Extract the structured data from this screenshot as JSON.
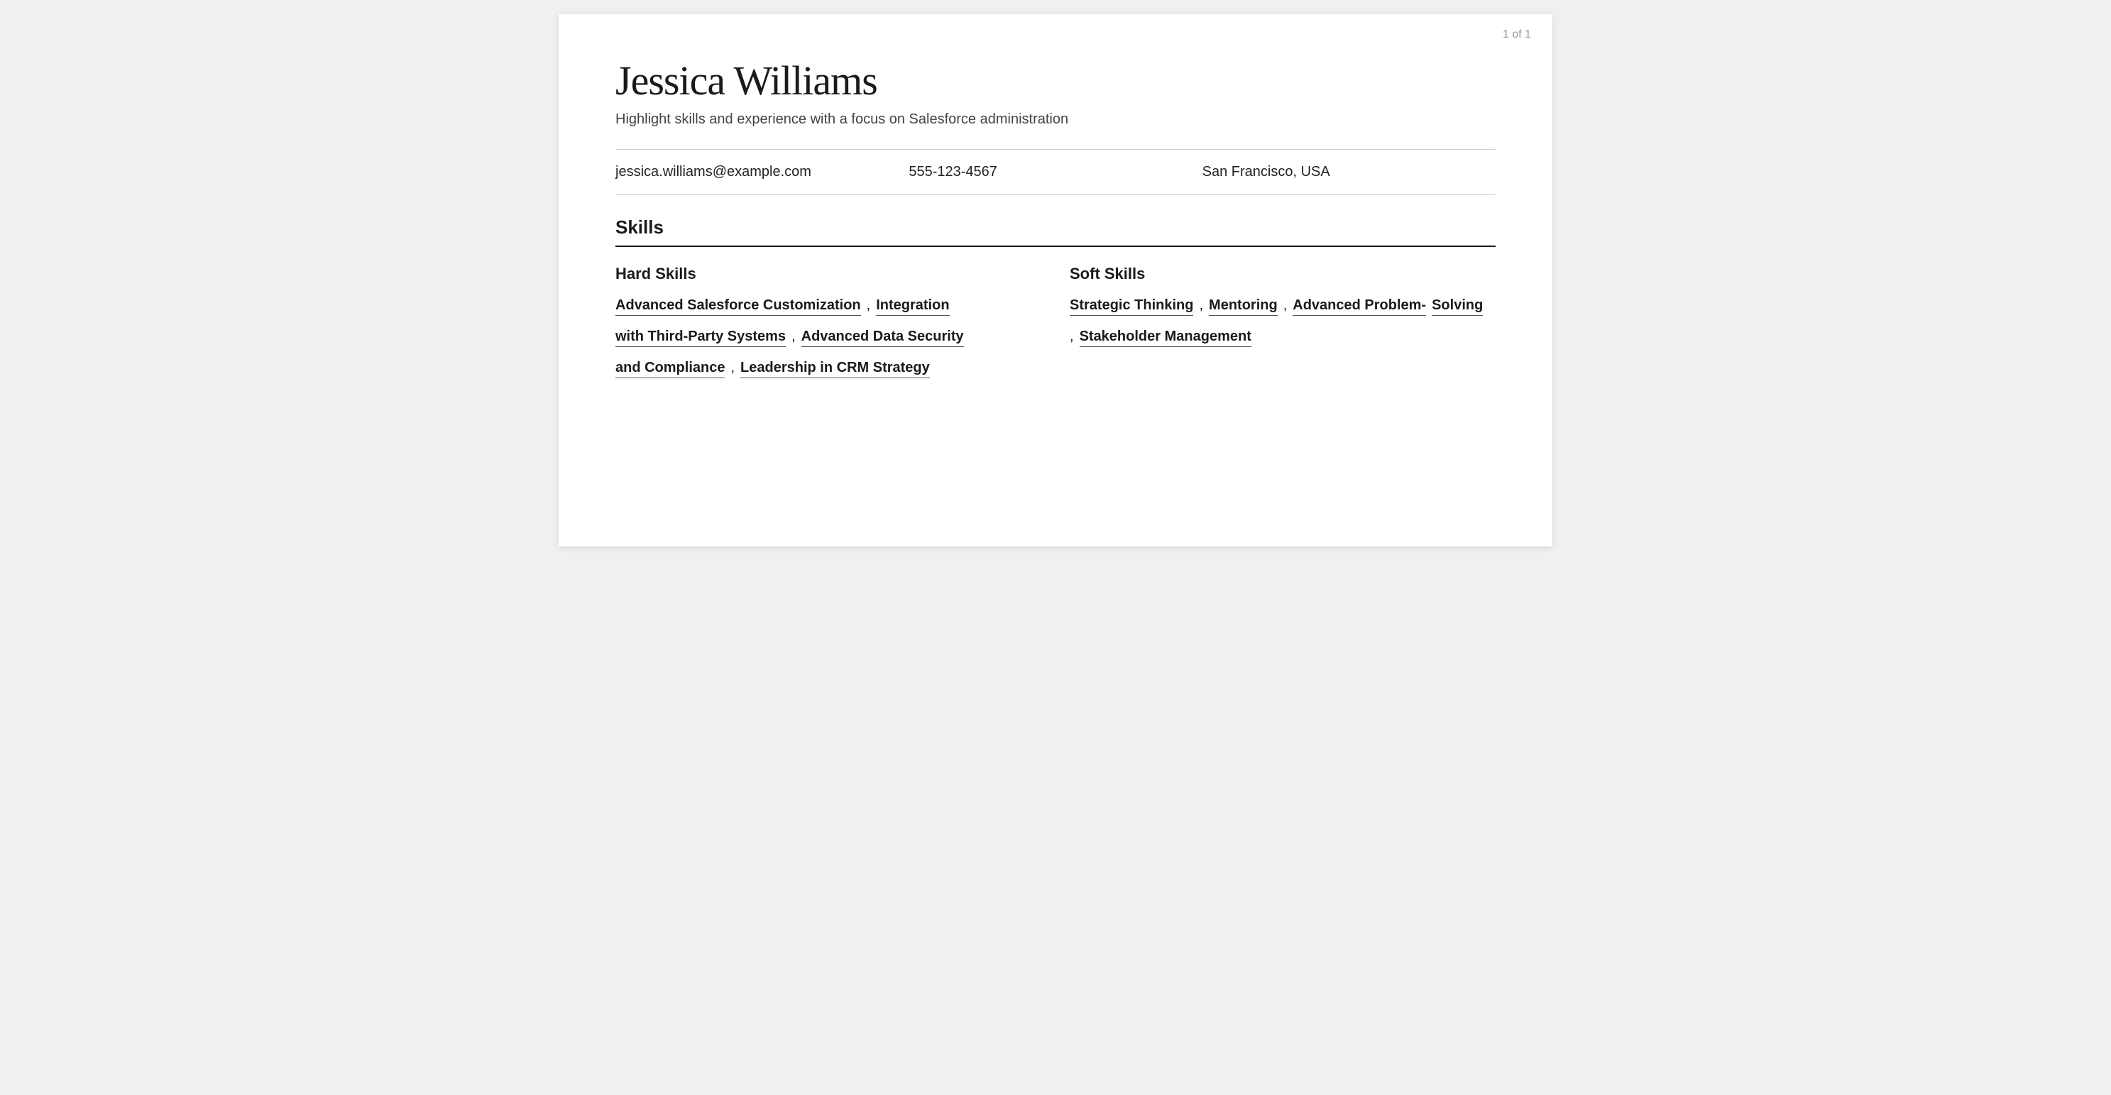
{
  "page": {
    "counter": "1 of 1",
    "name": "Jessica Williams",
    "subtitle": "Highlight skills and experience with a focus on Salesforce administration",
    "contact": {
      "email": "jessica.williams@example.com",
      "phone": "555-123-4567",
      "location": "San Francisco, USA"
    },
    "sections": {
      "skills": {
        "header": "Skills",
        "hard_skills": {
          "title": "Hard Skills",
          "items": [
            "Advanced Salesforce Customization",
            "Integration with Third-Party Systems",
            "Advanced Data Security and Compliance",
            "Leadership in CRM Strategy"
          ]
        },
        "soft_skills": {
          "title": "Soft Skills",
          "items": [
            "Strategic Thinking",
            "Mentoring",
            "Advanced Problem-Solving",
            "Stakeholder Management"
          ]
        }
      }
    }
  }
}
